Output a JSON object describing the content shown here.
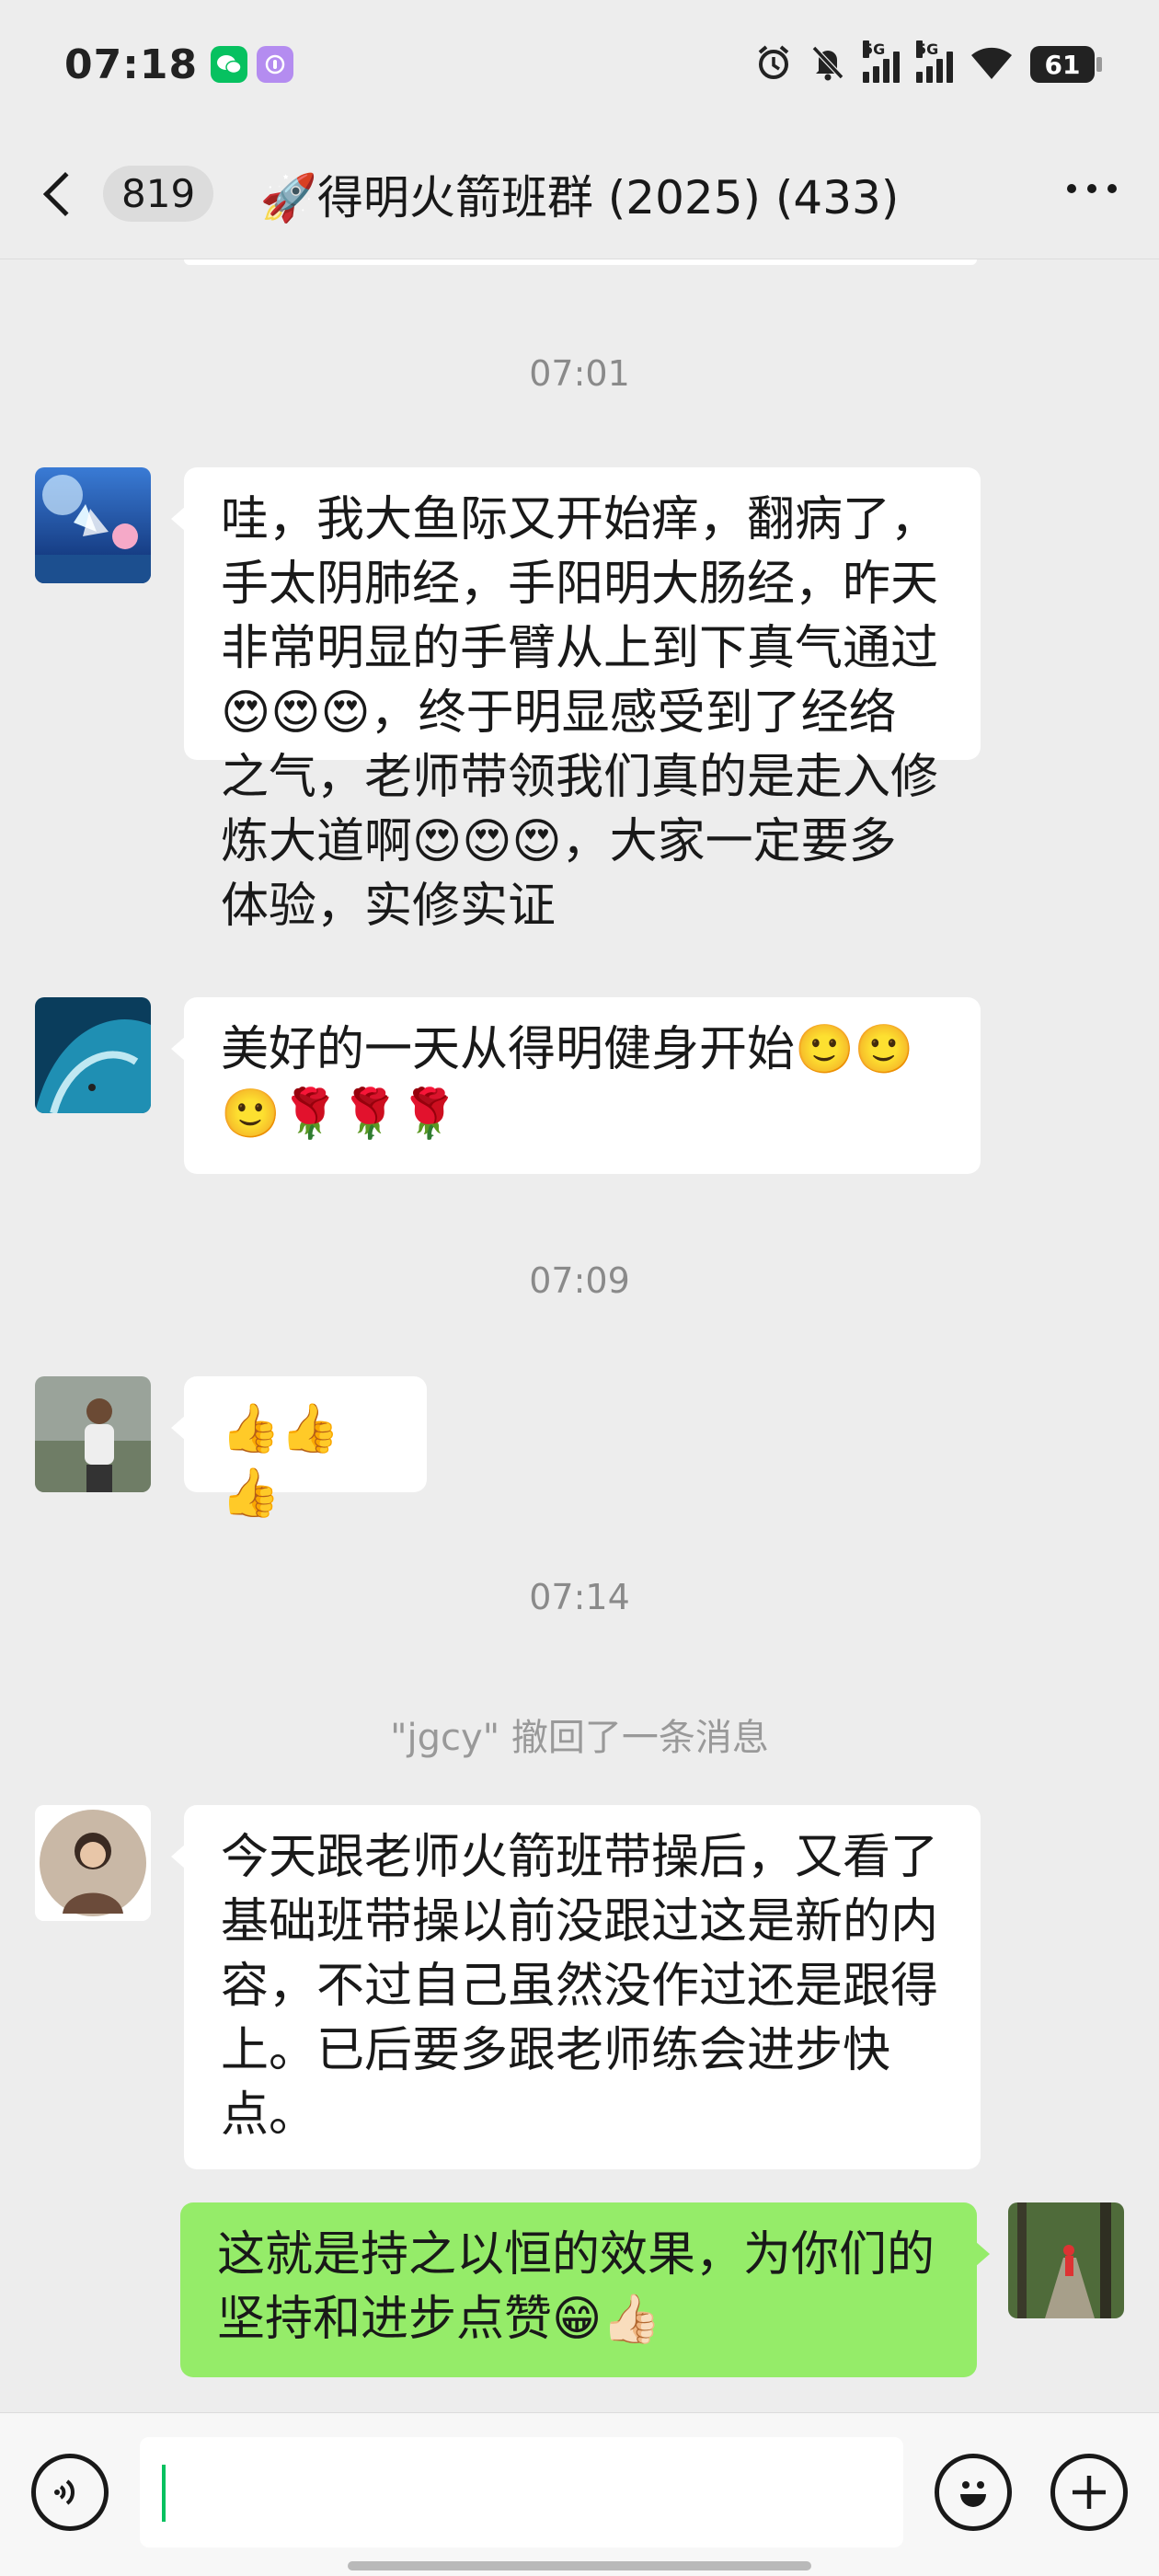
{
  "status_bar": {
    "time": "07:18",
    "icons": [
      "wechat-icon",
      "podcast-icon",
      "alarm-icon",
      "mute-bell-icon",
      "signal-5g-icon",
      "signal-5g-icon",
      "wifi-icon",
      "battery-icon"
    ],
    "net1": "5G",
    "net2": "5G",
    "battery": "61"
  },
  "nav": {
    "unread_count": "819",
    "title": "🚀得明火箭班群 (2025) (433)"
  },
  "messages": {
    "ts1": "07:01",
    "m1_text": "哇，我大鱼际又开始痒，翻病了，手太阴肺经，手阳明大肠经，昨天非常明显的手臂从上到下真气通过😍😍😍，终于明显感受到了经络之气，老师带领我们真的是走入修炼大道啊😍😍😍，大家一定要多体验，实修实证",
    "m2_text": "美好的一天从得明健身开始🙂🙂🙂🌹🌹🌹",
    "ts2": "07:09",
    "m3_text": "👍👍👍",
    "ts3": "07:14",
    "recall_notice": "\"jgcy\" 撤回了一条消息",
    "m4_text": "今天跟老师火箭班带操后，又看了基础班带操以前没跟过这是新的内容，不过自己虽然没作过还是跟得上。已后要多跟老师练会进步快点。",
    "m5_text": "这就是持之以恒的效果，为你们的坚持和进步点赞😁👍🏻"
  },
  "colors": {
    "background": "#ededed",
    "own_bubble": "#95ec69",
    "other_bubble": "#ffffff",
    "cursor": "#07c160"
  }
}
